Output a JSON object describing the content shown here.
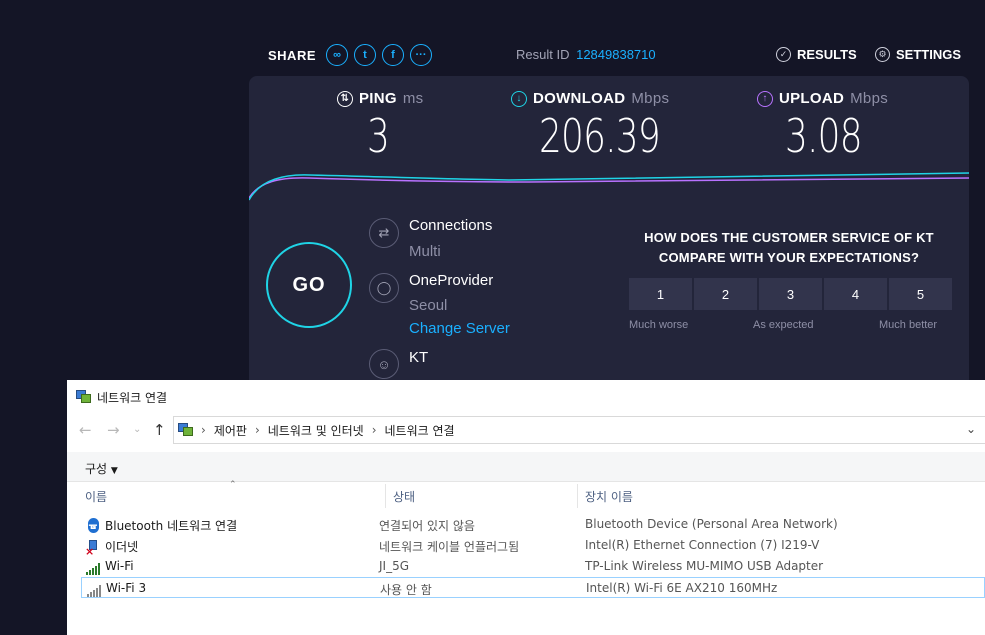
{
  "speedtest": {
    "share_label": "SHARE",
    "share_icons": [
      "link-icon",
      "twitter-icon",
      "facebook-icon",
      "more-icon"
    ],
    "result_id_label": "Result ID",
    "result_id": "12849838710",
    "results_label": "RESULTS",
    "settings_label": "SETTINGS",
    "ping": {
      "label": "PING",
      "unit": "ms",
      "value": "3"
    },
    "download": {
      "label": "DOWNLOAD",
      "unit": "Mbps",
      "value": "206.39"
    },
    "upload": {
      "label": "UPLOAD",
      "unit": "Mbps",
      "value": "3.08"
    },
    "go_label": "GO",
    "connections": {
      "title": "Connections",
      "value": "Multi"
    },
    "server": {
      "title": "OneProvider",
      "location": "Seoul",
      "change_label": "Change Server"
    },
    "isp": {
      "title": "KT"
    },
    "survey": {
      "question": "HOW DOES THE CUSTOMER SERVICE OF KT COMPARE WITH YOUR EXPECTATIONS?",
      "options": [
        "1",
        "2",
        "3",
        "4",
        "5"
      ],
      "low_label": "Much worse",
      "mid_label": "As expected",
      "high_label": "Much better"
    },
    "colors": {
      "download": "#1fd4e6",
      "upload": "#b872ff",
      "link": "#1ab0ff"
    }
  },
  "explorer": {
    "window_title": "네트워크 연결",
    "breadcrumb": [
      "제어판",
      "네트워크 및 인터넷",
      "네트워크 연결"
    ],
    "organize_label": "구성",
    "columns": {
      "name": "이름",
      "status": "상태",
      "device": "장치 이름"
    },
    "rows": [
      {
        "name": "Bluetooth 네트워크 연결",
        "status": "연결되어 있지 않음",
        "device": "Bluetooth Device (Personal Area Network)",
        "icon": "bluetooth-icon"
      },
      {
        "name": "이더넷",
        "status": "네트워크 케이블 언플러그됨",
        "device": "Intel(R) Ethernet Connection (7) I219-V",
        "icon": "ethernet-icon"
      },
      {
        "name": "Wi-Fi",
        "status": "JI_5G",
        "device": "TP-Link Wireless MU-MIMO USB Adapter",
        "icon": "wifi-signal-icon"
      },
      {
        "name": "Wi-Fi 3",
        "status": "사용 안 함",
        "device": "Intel(R) Wi-Fi 6E AX210 160MHz",
        "icon": "wifi-disabled-icon"
      }
    ]
  }
}
